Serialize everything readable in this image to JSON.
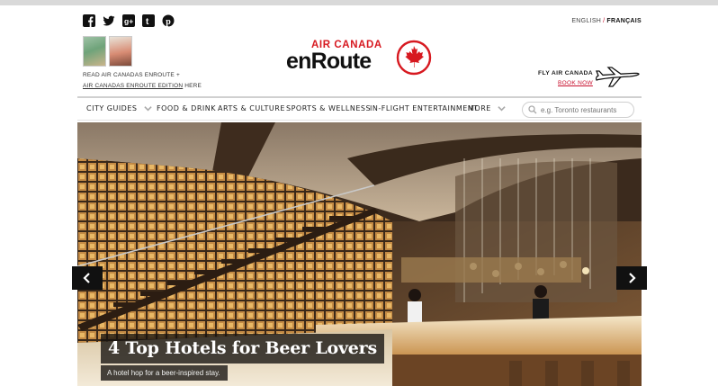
{
  "social": {
    "icons": [
      "facebook-icon",
      "twitter-icon",
      "google-plus-icon",
      "tumblr-icon",
      "pinterest-icon"
    ]
  },
  "language": {
    "english": "ENGLISH",
    "separator": "/",
    "french": "FRANÇAIS"
  },
  "promo": {
    "line1": "READ AIR CANADAS ENROUTE +",
    "line2_link": "AIR CANADAS ENROUTE EDITION",
    "line2_rest": " HERE"
  },
  "logo": {
    "air_canada": "AIR CANADA",
    "enroute": "enRoute",
    "brand_color": "#d71920"
  },
  "fly": {
    "title": "FLY AIR CANADA",
    "link": "BOOK NOW"
  },
  "nav": {
    "items": [
      {
        "label": "CITY GUIDES",
        "has_dropdown": true
      },
      {
        "label": "FOOD & DRINK",
        "has_dropdown": false
      },
      {
        "label": "ARTS & CULTURE",
        "has_dropdown": false
      },
      {
        "label": "SPORTS & WELLNESS",
        "has_dropdown": false
      },
      {
        "label": "IN-FLIGHT ENTERTAINMENT",
        "has_dropdown": false
      },
      {
        "label": "MORE",
        "has_dropdown": true
      }
    ],
    "search_placeholder": "e.g. Toronto restaurants"
  },
  "hero": {
    "title": "4 Top Hotels for Beer Lovers",
    "subtitle": "A hotel hop for a beer-inspired stay."
  }
}
